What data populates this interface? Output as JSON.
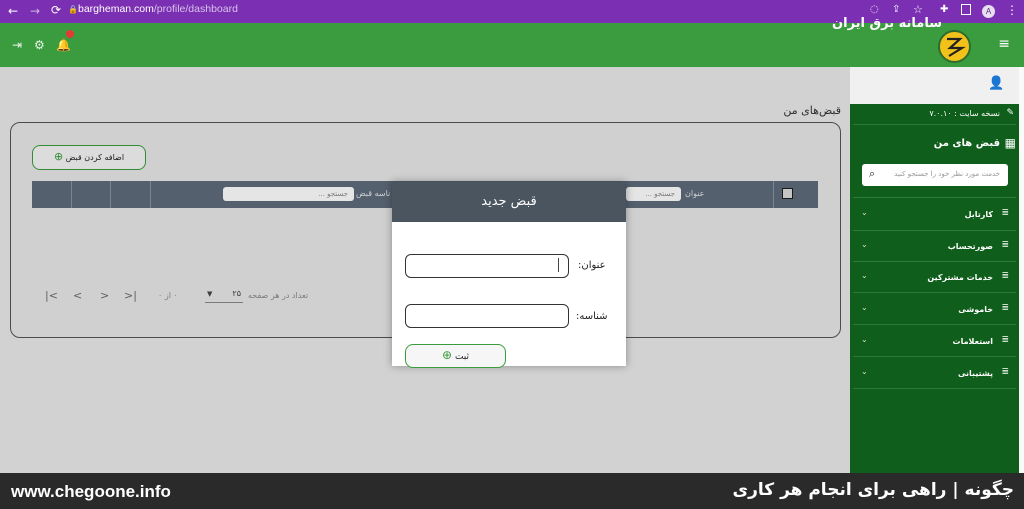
{
  "browser": {
    "url_domain": "bargheman.com",
    "url_path": "/profile/dashboard",
    "profile_initial": "A"
  },
  "header": {
    "brand": "سامانه برق ایران",
    "notification_count": "1"
  },
  "sidebar": {
    "version": "نسخه سایت : ۷.۰.۱۰",
    "my_bills": "قبض های من",
    "search_placeholder": "خدمت مورد نظر خود را جستجو کنید",
    "items": [
      {
        "label": "کارتابل"
      },
      {
        "label": "صورتحساب"
      },
      {
        "label": "خدمات مشترکین"
      },
      {
        "label": "خاموشی"
      },
      {
        "label": "استعلامات"
      },
      {
        "label": "پشتیبانی"
      }
    ]
  },
  "main": {
    "title": "قبض‌های من",
    "add_button": "اضافه کردن قبض",
    "table": {
      "col_title": "عنوان",
      "col_id": "ناسه قبض",
      "search_placeholder": "جستجو ..."
    },
    "pagination": {
      "per_page_label": "تعداد در هر صفحه",
      "per_page_value": "۲۵",
      "range": "۰ از ۰"
    }
  },
  "modal": {
    "title": "قبض جدید",
    "field_title_label": "عنوان:",
    "field_id_label": "شناسه:",
    "submit_label": "ثبت"
  },
  "footer": {
    "site": "www.chegoone.info",
    "tagline": "چگونه | راهی برای انجام هر کاری"
  },
  "colors": {
    "chrome": "#7b2fb3",
    "header_green": "#3a9c3e",
    "sidebar_green": "#0f5e1b",
    "table_head": "#5e6b7a",
    "modal_head": "#4a5560"
  }
}
